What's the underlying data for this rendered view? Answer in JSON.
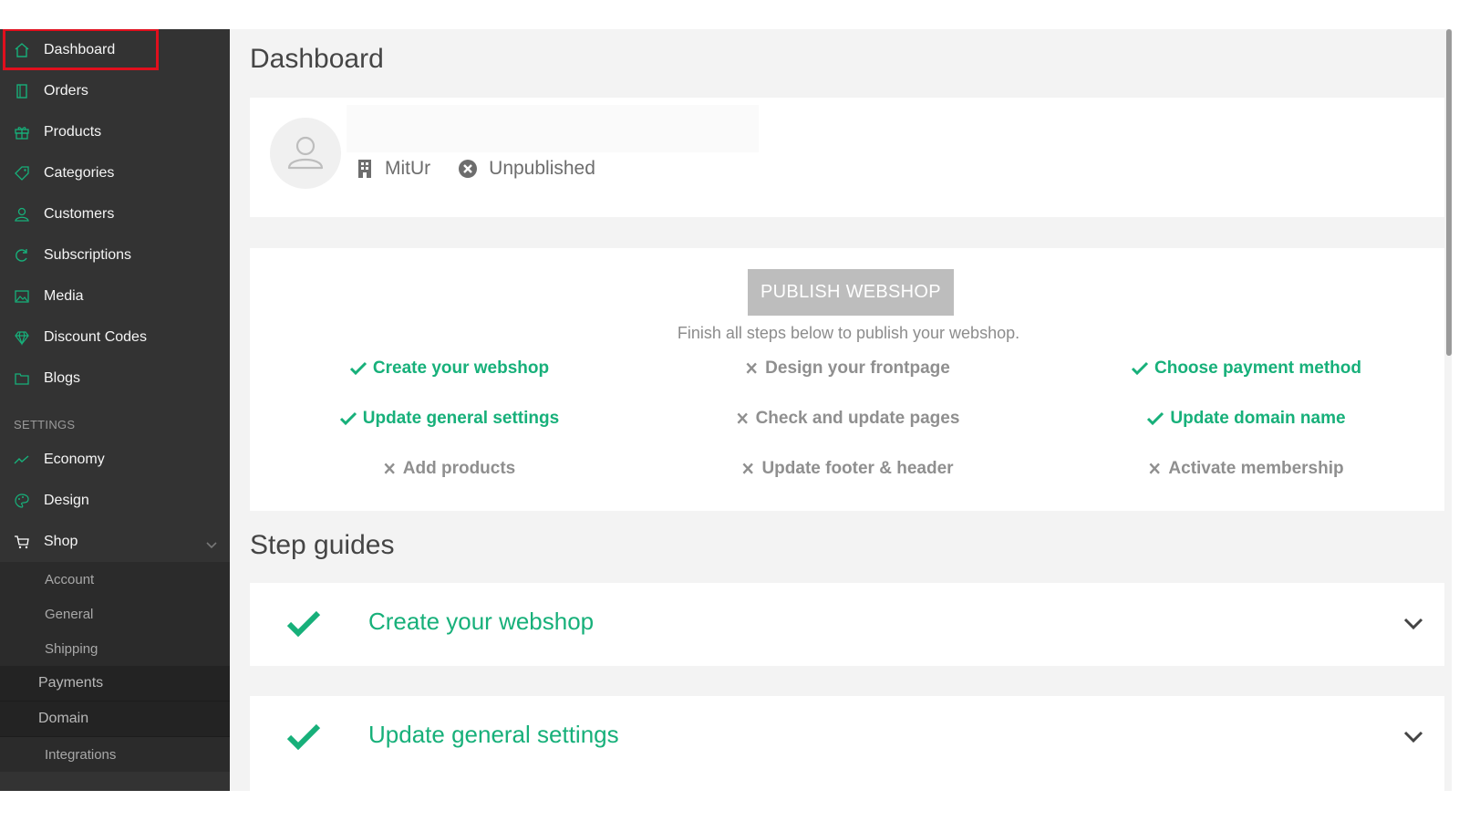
{
  "sidebar": {
    "items": [
      {
        "label": "Dashboard",
        "icon": "home-icon",
        "active": true
      },
      {
        "label": "Orders",
        "icon": "book-icon"
      },
      {
        "label": "Products",
        "icon": "gift-icon"
      },
      {
        "label": "Categories",
        "icon": "tag-icon"
      },
      {
        "label": "Customers",
        "icon": "user-icon"
      },
      {
        "label": "Subscriptions",
        "icon": "refresh-icon"
      },
      {
        "label": "Media",
        "icon": "image-icon"
      },
      {
        "label": "Discount Codes",
        "icon": "diamond-icon"
      },
      {
        "label": "Blogs",
        "icon": "folder-icon"
      }
    ],
    "settings_label": "SETTINGS",
    "settings_items": [
      {
        "label": "Economy",
        "icon": "trend-icon"
      },
      {
        "label": "Design",
        "icon": "palette-icon"
      },
      {
        "label": "Shop",
        "icon": "cart-icon",
        "expanded": true
      }
    ],
    "shop_subitems": [
      "Account",
      "General",
      "Shipping",
      "Payments",
      "Domain",
      "Integrations"
    ],
    "accent_color": "#17b07a",
    "highlight_color": "#e00f1d"
  },
  "main": {
    "title": "Dashboard",
    "profile": {
      "shop_name": "MitUr",
      "status": "Unpublished"
    },
    "publish": {
      "button_label": "PUBLISH WEBSHOP",
      "hint": "Finish all steps below to publish your webshop.",
      "steps": [
        {
          "label": "Create your webshop",
          "done": true
        },
        {
          "label": "Design your frontpage",
          "done": false
        },
        {
          "label": "Choose payment method",
          "done": true
        },
        {
          "label": "Update general settings",
          "done": true
        },
        {
          "label": "Check and update pages",
          "done": false
        },
        {
          "label": "Update domain name",
          "done": true
        },
        {
          "label": "Add products",
          "done": false
        },
        {
          "label": "Update footer & header",
          "done": false
        },
        {
          "label": "Activate membership",
          "done": false
        }
      ]
    },
    "guides_title": "Step guides",
    "guides": [
      {
        "label": "Create your webshop",
        "done": true
      },
      {
        "label": "Update general settings",
        "done": true
      }
    ]
  }
}
